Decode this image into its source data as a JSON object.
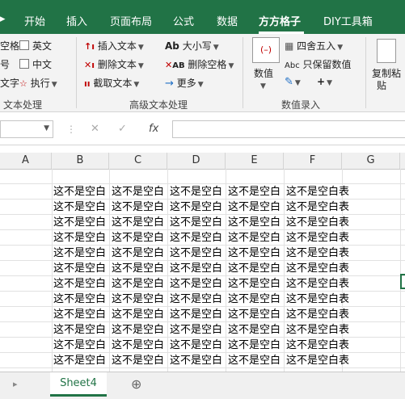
{
  "tabs": [
    "开始",
    "插入",
    "页面布局",
    "公式",
    "数据",
    "方方格子",
    "DIY工具箱"
  ],
  "active_tab": "方方格子",
  "ribbon": {
    "left_partial": {
      "rows": [
        "空格",
        "号",
        "文字"
      ],
      "english_label": "英文",
      "chinese_label": "中文",
      "execute_label": "执行",
      "group_label": "文本处理"
    },
    "advanced": {
      "insert_text": "插入文本",
      "delete_text": "删除文本",
      "extract_text": "截取文本",
      "case_label": "大小写",
      "delete_space": "删除空格",
      "more_label": "更多",
      "group_label": "高级文本处理"
    },
    "number": {
      "numeric_label": "数值",
      "round_label": "四舍五入",
      "keep_numeric": "只保留数值",
      "group_label": "数值录入"
    },
    "copy_paste": {
      "label_line1": "复制粘",
      "label_line2": "贴"
    }
  },
  "formula_bar": {
    "fx_label": "fx",
    "cancel_icon": "✕",
    "confirm_icon": "✓"
  },
  "columns": [
    "A",
    "B",
    "C",
    "D",
    "E",
    "F",
    "G"
  ],
  "cells": {
    "text_short": "这不是空白",
    "text_full": "这不是空白表",
    "filled_rows": 12
  },
  "sheets": {
    "active": "Sheet4",
    "add_icon": "⊕"
  },
  "scroll_left_icon": "▸"
}
